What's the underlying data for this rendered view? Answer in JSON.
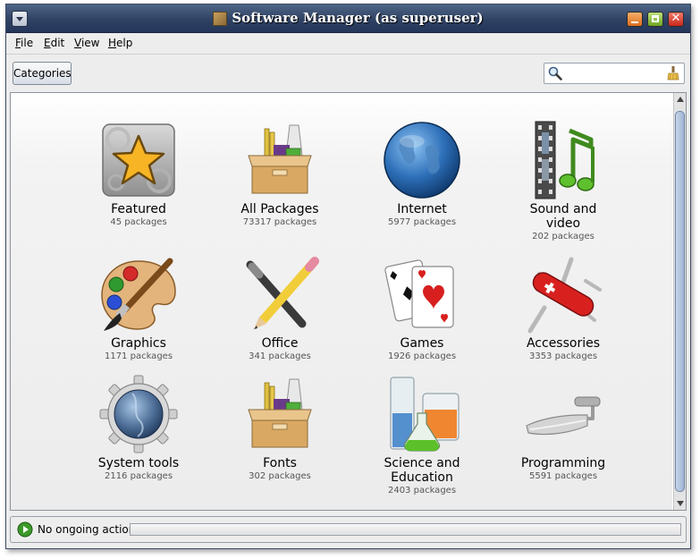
{
  "window": {
    "title": "Software Manager (as superuser)"
  },
  "menu": {
    "file": "File",
    "edit": "Edit",
    "view": "View",
    "help": "Help"
  },
  "toolbar": {
    "categories_label": "Categories",
    "search_value": ""
  },
  "categories": [
    {
      "name": "Featured",
      "count": "45 packages",
      "icon": "star-icon"
    },
    {
      "name": "All Packages",
      "count": "73317 packages",
      "icon": "package-box-icon"
    },
    {
      "name": "Internet",
      "count": "5977 packages",
      "icon": "globe-icon"
    },
    {
      "name": "Sound and\nvideo",
      "count": "202 packages",
      "icon": "film-music-icon"
    },
    {
      "name": "Graphics",
      "count": "1171 packages",
      "icon": "palette-icon"
    },
    {
      "name": "Office",
      "count": "341 packages",
      "icon": "pen-pencil-icon"
    },
    {
      "name": "Games",
      "count": "1926 packages",
      "icon": "playing-cards-icon"
    },
    {
      "name": "Accessories",
      "count": "3353 packages",
      "icon": "swiss-knife-icon"
    },
    {
      "name": "System tools",
      "count": "2116 packages",
      "icon": "gear-icon"
    },
    {
      "name": "Fonts",
      "count": "302 packages",
      "icon": "package-box-icon"
    },
    {
      "name": "Science and\nEducation",
      "count": "2403 packages",
      "icon": "flask-icon"
    },
    {
      "name": "Programming",
      "count": "5591 packages",
      "icon": "trowel-icon"
    }
  ],
  "status": {
    "text": "No ongoing actions",
    "progress": 0
  }
}
